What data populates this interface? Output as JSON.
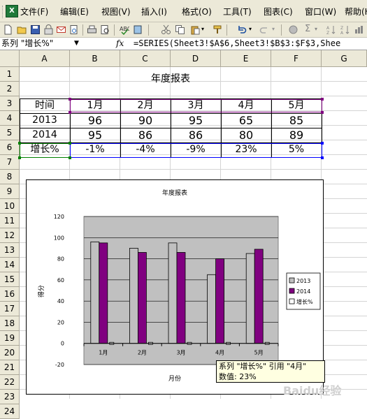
{
  "menubar": {
    "items": [
      {
        "label": "文件(F)"
      },
      {
        "label": "编辑(E)"
      },
      {
        "label": "视图(V)"
      },
      {
        "label": "插入(I)"
      },
      {
        "label": "格式(O)"
      },
      {
        "label": "工具(T)"
      },
      {
        "label": "图表(C)"
      },
      {
        "label": "窗口(W)"
      },
      {
        "label": "帮助(H)"
      }
    ]
  },
  "formula_bar": {
    "name_box": "系列 \"增长%\"",
    "fx": "fx",
    "formula": "=SERIES(Sheet3!$A$6,Sheet3!$B$3:$F$3,Shee"
  },
  "columns": [
    "A",
    "B",
    "C",
    "D",
    "E",
    "F",
    "G"
  ],
  "rows": [
    "1",
    "2",
    "3",
    "4",
    "5",
    "6",
    "7",
    "8",
    "9",
    "10",
    "11",
    "12",
    "13",
    "14",
    "15",
    "16",
    "17",
    "18",
    "19",
    "20",
    "21",
    "22",
    "23",
    "24"
  ],
  "sheet": {
    "title": "年度报表",
    "table": [
      [
        "时间",
        "1月",
        "2月",
        "3月",
        "4月",
        "5月"
      ],
      [
        "2013",
        "96",
        "90",
        "95",
        "65",
        "85"
      ],
      [
        "2014",
        "95",
        "86",
        "86",
        "80",
        "89"
      ],
      [
        "增长%",
        "-1%",
        "-4%",
        "-9%",
        "23%",
        "5%"
      ]
    ]
  },
  "chart_data": {
    "type": "bar",
    "title": "年度报表",
    "xlabel": "月份",
    "ylabel": "得分",
    "categories": [
      "1月",
      "2月",
      "3月",
      "4月",
      "5月"
    ],
    "series": [
      {
        "name": "2013",
        "values": [
          96,
          90,
          95,
          65,
          85
        ],
        "color": "#c0c0c0"
      },
      {
        "name": "2014",
        "values": [
          95,
          86,
          86,
          80,
          89
        ],
        "color": "#800080"
      },
      {
        "name": "增长%",
        "values": [
          -1,
          -4,
          -9,
          23,
          5
        ],
        "color": "#ffffff"
      }
    ],
    "ylim": [
      -20,
      120
    ],
    "yticks": [
      "-20",
      "0",
      "20",
      "40",
      "60",
      "80",
      "100",
      "120"
    ],
    "plot_bg": "#c0c0c0",
    "grid": true,
    "legend": "right"
  },
  "tooltip": {
    "line1": "系列 \"增长%\" 引用 \"4月\"",
    "line2": "数值: 23%"
  },
  "watermark": "Baidu经验"
}
